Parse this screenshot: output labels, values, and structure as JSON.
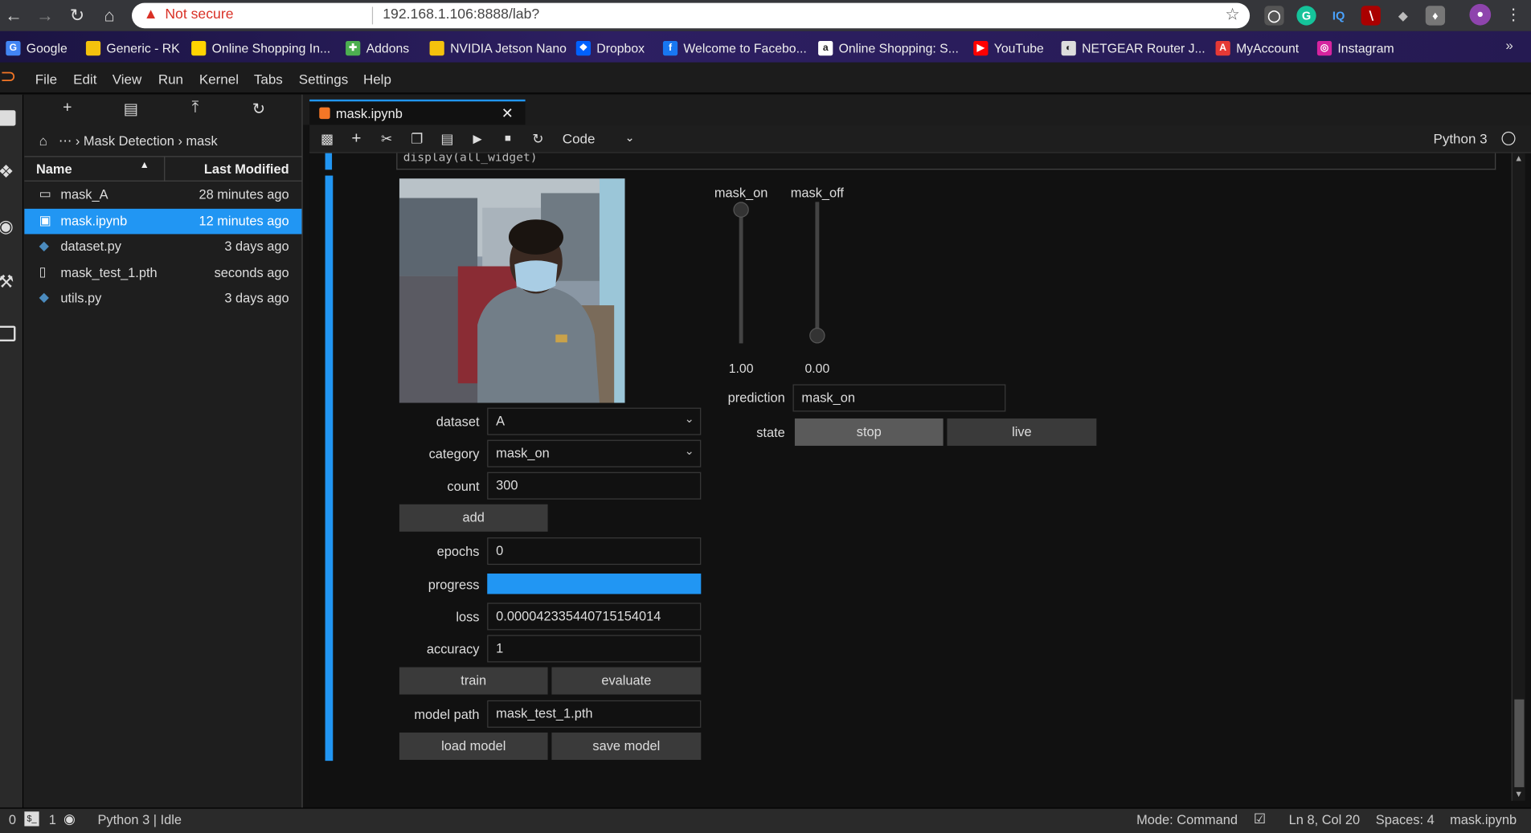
{
  "browser": {
    "security_label": "Not secure",
    "url": "192.168.1.106:8888/lab?",
    "bookmarks": [
      {
        "label": "Google",
        "color": "#4285f4",
        "glyph": "G"
      },
      {
        "label": "Generic - RK",
        "color": "#f4c20d",
        "glyph": ""
      },
      {
        "label": "Online Shopping In...",
        "color": "#ffd400",
        "glyph": ""
      },
      {
        "label": "Addons",
        "color": "#4caf50",
        "glyph": "✚"
      },
      {
        "label": "NVIDIA Jetson Nano",
        "color": "#f4c20d",
        "glyph": ""
      },
      {
        "label": "Dropbox",
        "color": "#0061fe",
        "glyph": "❖"
      },
      {
        "label": "Welcome to Facebo...",
        "color": "#1877f2",
        "glyph": "f"
      },
      {
        "label": "Online Shopping: S...",
        "color": "#ffffff",
        "glyph": "a"
      },
      {
        "label": "YouTube",
        "color": "#ff0000",
        "glyph": "▶"
      },
      {
        "label": "NETGEAR Router J...",
        "color": "#dddddd",
        "glyph": "◐"
      },
      {
        "label": "MyAccount",
        "color": "#e53935",
        "glyph": "A"
      },
      {
        "label": "Instagram",
        "color": "#d6249f",
        "glyph": "◎"
      }
    ]
  },
  "menubar": [
    "File",
    "Edit",
    "View",
    "Run",
    "Kernel",
    "Tabs",
    "Settings",
    "Help"
  ],
  "filebrowser": {
    "breadcrumb": "⋯ › Mask Detection › mask",
    "col_name": "Name",
    "col_modified": "Last Modified",
    "files": [
      {
        "name": "mask_A",
        "modified": "28 minutes ago",
        "type": "folder"
      },
      {
        "name": "mask.ipynb",
        "modified": "12 minutes ago",
        "type": "notebook"
      },
      {
        "name": "dataset.py",
        "modified": "3 days ago",
        "type": "python"
      },
      {
        "name": "mask_test_1.pth",
        "modified": "seconds ago",
        "type": "file"
      },
      {
        "name": "utils.py",
        "modified": "3 days ago",
        "type": "python"
      }
    ]
  },
  "notebook": {
    "tab_title": "mask.ipynb",
    "cell_type": "Code",
    "kernel": "Python 3",
    "code_line": "display(all_widget)"
  },
  "widgets": {
    "dataset_label": "dataset",
    "dataset_value": "A",
    "category_label": "category",
    "category_value": "mask_on",
    "count_label": "count",
    "count_value": "300",
    "add_label": "add",
    "epochs_label": "epochs",
    "epochs_value": "0",
    "progress_label": "progress",
    "progress_value": 1.0,
    "loss_label": "loss",
    "loss_value": "0.000042335440715154014",
    "accuracy_label": "accuracy",
    "accuracy_value": "1",
    "train_label": "train",
    "evaluate_label": "evaluate",
    "model_path_label": "model path",
    "model_path_value": "mask_test_1.pth",
    "load_label": "load model",
    "save_label": "save model",
    "slider1_label": "mask_on",
    "slider1_value": "1.00",
    "slider1_level": 1.0,
    "slider2_label": "mask_off",
    "slider2_value": "0.00",
    "slider2_level": 0.0,
    "prediction_label": "prediction",
    "prediction_value": "mask_on",
    "state_label": "state",
    "stop_label": "stop",
    "live_label": "live"
  },
  "statusbar": {
    "count1": "0",
    "count2": "1",
    "kernel_status": "Python 3 | Idle",
    "mode": "Mode: Command",
    "position": "Ln 8, Col 20",
    "spaces": "Spaces: 4",
    "filename": "mask.ipynb"
  },
  "colors": {
    "accent": "#2196f3",
    "warning": "#d93025"
  }
}
